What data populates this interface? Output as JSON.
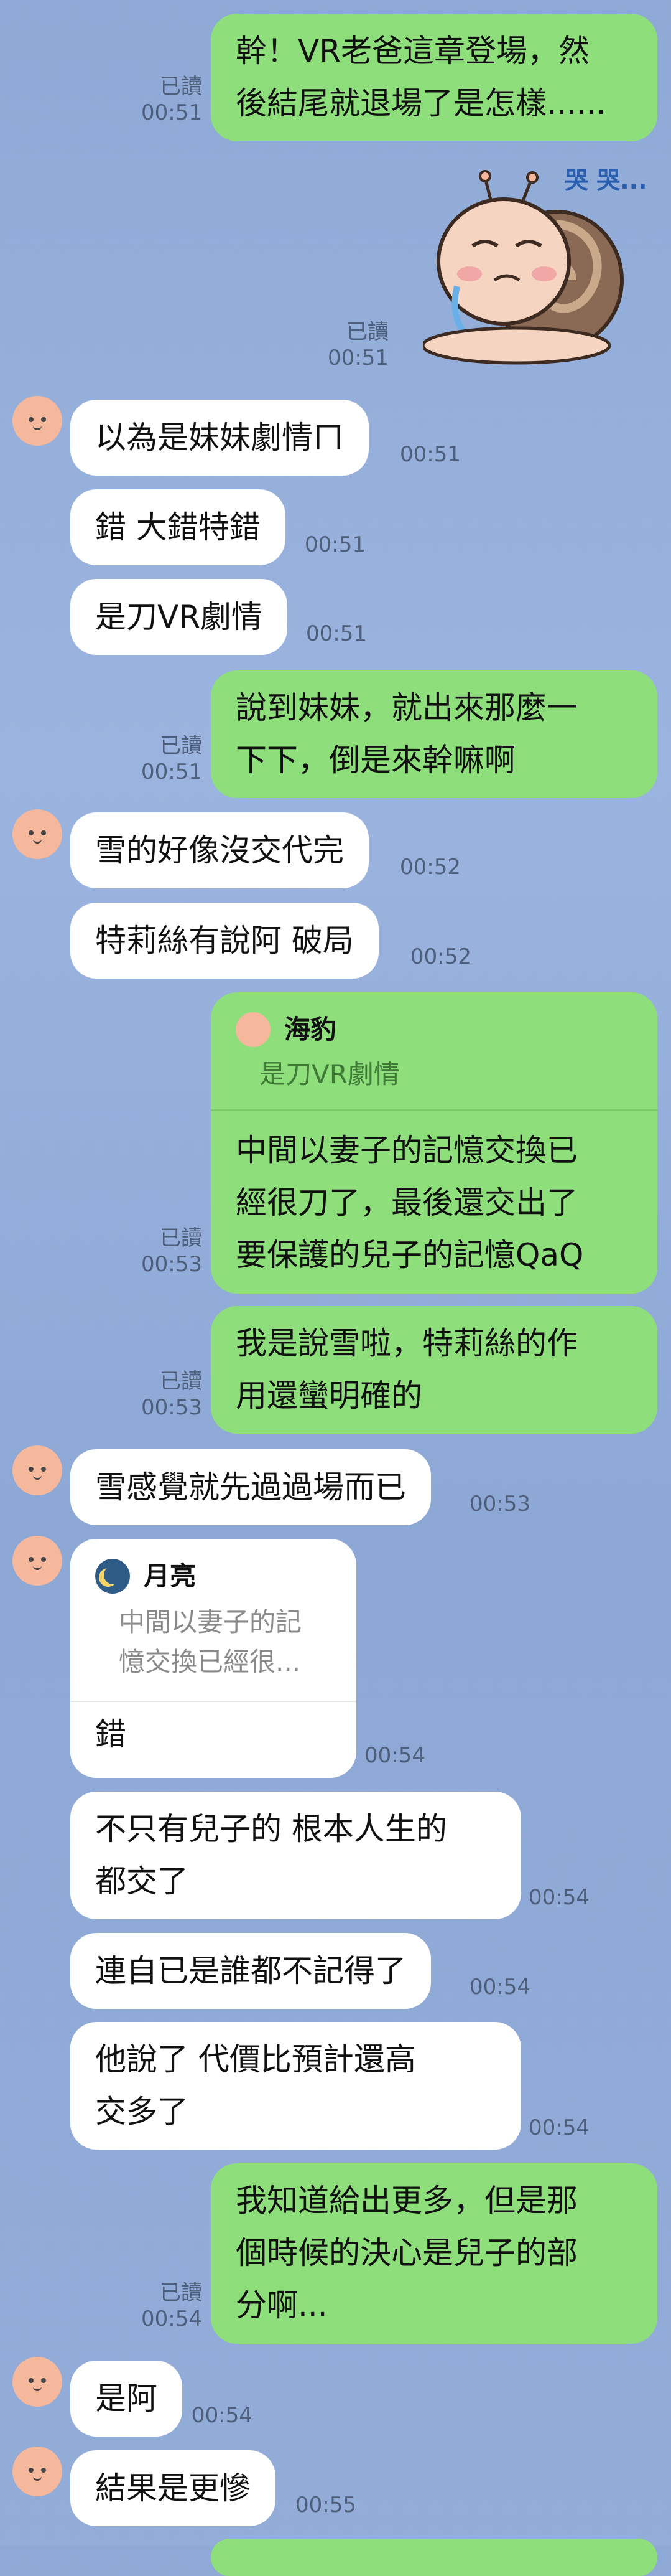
{
  "messages": [
    {
      "side": "out",
      "text": "幹！VR老爸這章登場，然後結尾就退場了是怎樣......",
      "read": "已讀",
      "time": "00:51"
    },
    {
      "side": "out",
      "sticker": "crying-snail-sticker",
      "read": "已讀",
      "time": "00:51"
    },
    {
      "side": "in",
      "text": "以為是妹妹劇情ㄇ",
      "time": "00:51"
    },
    {
      "side": "in",
      "text": "錯 大錯特錯",
      "time": "00:51"
    },
    {
      "side": "in",
      "text": "是刀VR劇情",
      "time": "00:51"
    },
    {
      "side": "out",
      "text": "說到妹妹，就出來那麼一下下，倒是來幹嘛啊",
      "read": "已讀",
      "time": "00:51"
    },
    {
      "side": "in",
      "text": "雪的好像沒交代完",
      "time": "00:52"
    },
    {
      "side": "in",
      "text": "特莉絲有說阿 破局",
      "time": "00:52"
    },
    {
      "side": "out",
      "reply_to": {
        "name": "海豹",
        "text": "是刀VR劇情"
      },
      "text": "中間以妻子的記憶交換已經很刀了，最後還交出了要保護的兒子的記憶QaQ",
      "read": "已讀",
      "time": "00:53"
    },
    {
      "side": "out",
      "text": "我是說雪啦，特莉絲的作用還蠻明確的",
      "read": "已讀",
      "time": "00:53"
    },
    {
      "side": "in",
      "text": "雪感覺就先過過場而已",
      "time": "00:53"
    },
    {
      "side": "in",
      "reply_to": {
        "name": "月亮",
        "text": "中間以妻子的記憶交換已經很..."
      },
      "text": "錯",
      "time": "00:54"
    },
    {
      "side": "in",
      "text": "不只有兒子的 根本人生的都交了",
      "time": "00:54"
    },
    {
      "side": "in",
      "text": "連自已是誰都不記得了",
      "time": "00:54"
    },
    {
      "side": "in",
      "text": "他說了 代價比預計還高交多了",
      "time": "00:54"
    },
    {
      "side": "out",
      "text": "我知道給出更多，但是那個時候的決心是兒子的部分啊...",
      "read": "已讀",
      "time": "00:54"
    },
    {
      "side": "in",
      "text": "是阿",
      "time": "00:54"
    },
    {
      "side": "in",
      "text": "結果是更慘",
      "time": "00:55"
    }
  ],
  "text": {
    "m0_l1": "幹！VR老爸這章登場，然",
    "m0_l2": "後結尾就退場了是怎樣......",
    "m5_l1": "說到妹妹，就出來那麼一",
    "m5_l2": "下下，倒是來幹嘛啊",
    "m8_q_name": "海豹",
    "m8_q_text": "是刀VR劇情",
    "m8_l1": "中間以妻子的記憶交換已",
    "m8_l2": "經很刀了，最後還交出了",
    "m8_l3": "要保護的兒子的記憶QaQ",
    "m9_l1": "我是說雪啦，特莉絲的作",
    "m9_l2": "用還蠻明確的",
    "m11_q_name": "月亮",
    "m11_q_l1": "中間以妻子的記",
    "m11_q_l2": "憶交換已經很...",
    "m12_l1": "不只有兒子的 根本人生的",
    "m12_l2": "都交了",
    "m14_l1": "他說了 代價比預計還高",
    "m14_l2": "交多了",
    "m15_l1": "我知道給出更多，但是那",
    "m15_l2": "個時候的決心是兒子的部",
    "m15_l3": "分啊..."
  },
  "sticker_caption": "哭 哭...",
  "colors": {
    "outgoing": "#8ede7c",
    "incoming": "#ffffff",
    "background": "#93acd8",
    "meta": "#4e5f7c"
  }
}
